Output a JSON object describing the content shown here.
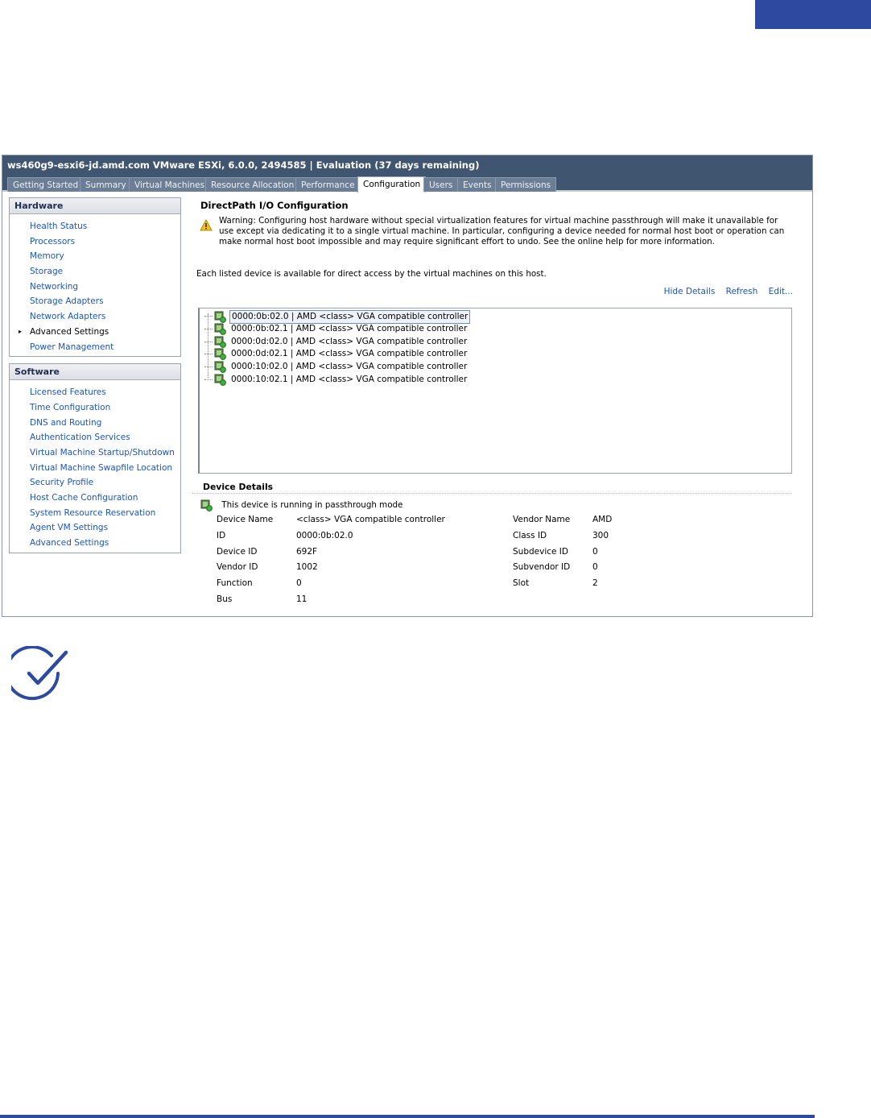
{
  "window": {
    "title": "ws460g9-esxi6-jd.amd.com VMware ESXi, 6.0.0, 2494585 | Evaluation (37 days remaining)"
  },
  "tabs": [
    {
      "label": "Getting Started"
    },
    {
      "label": "Summary"
    },
    {
      "label": "Virtual Machines"
    },
    {
      "label": "Resource Allocation"
    },
    {
      "label": "Performance"
    },
    {
      "label": "Configuration",
      "active": true
    },
    {
      "label": "Users"
    },
    {
      "label": "Events"
    },
    {
      "label": "Permissions"
    }
  ],
  "hardware": {
    "header": "Hardware",
    "items": [
      {
        "label": "Health Status"
      },
      {
        "label": "Processors"
      },
      {
        "label": "Memory"
      },
      {
        "label": "Storage"
      },
      {
        "label": "Networking"
      },
      {
        "label": "Storage Adapters"
      },
      {
        "label": "Network Adapters"
      },
      {
        "label": "Advanced Settings",
        "current": true
      },
      {
        "label": "Power Management"
      }
    ]
  },
  "software": {
    "header": "Software",
    "items": [
      {
        "label": "Licensed Features"
      },
      {
        "label": "Time Configuration"
      },
      {
        "label": "DNS and Routing"
      },
      {
        "label": "Authentication Services"
      },
      {
        "label": "Virtual Machine Startup/Shutdown"
      },
      {
        "label": "Virtual Machine Swapfile Location"
      },
      {
        "label": "Security Profile"
      },
      {
        "label": "Host Cache Configuration"
      },
      {
        "label": "System Resource Reservation"
      },
      {
        "label": "Agent VM Settings"
      },
      {
        "label": "Advanced Settings"
      }
    ]
  },
  "main": {
    "title": "DirectPath I/O Configuration",
    "warning": "Warning: Configuring host hardware without special virtualization features for virtual machine passthrough will make it unavailable for use except via dedicating it to a single virtual machine. In particular, configuring a device needed for normal host boot or operation can make normal host boot impossible and may require significant effort to undo. See the online help for more information.",
    "info": "Each listed device is available for direct access by the virtual machines on this host.",
    "links": {
      "hide_details": "Hide Details",
      "refresh": "Refresh",
      "edit": "Edit..."
    },
    "devices": [
      {
        "label": "0000:0b:02.0 | AMD <class> VGA compatible controller",
        "selected": true
      },
      {
        "label": "0000:0b:02.1 | AMD <class> VGA compatible controller"
      },
      {
        "label": "0000:0d:02.0 | AMD <class> VGA compatible controller"
      },
      {
        "label": "0000:0d:02.1 | AMD <class> VGA compatible controller"
      },
      {
        "label": "0000:10:02.0 | AMD <class> VGA compatible controller"
      },
      {
        "label": "0000:10:02.1 | AMD <class> VGA compatible controller"
      }
    ],
    "details": {
      "title": "Device Details",
      "status": "This device is running in passthrough mode",
      "left": [
        {
          "label": "Device Name",
          "value": "<class> VGA compatible controller"
        },
        {
          "label": "ID",
          "value": "0000:0b:02.0"
        },
        {
          "label": "Device ID",
          "value": "692F"
        },
        {
          "label": "Vendor ID",
          "value": "1002"
        },
        {
          "label": "Function",
          "value": "0"
        },
        {
          "label": "Bus",
          "value": "11"
        }
      ],
      "right": [
        {
          "label": "Vendor Name",
          "value": "AMD"
        },
        {
          "label": "Class ID",
          "value": "300"
        },
        {
          "label": "Subdevice ID",
          "value": "0"
        },
        {
          "label": "Subvendor ID",
          "value": "0"
        },
        {
          "label": "Slot",
          "value": "2"
        }
      ]
    }
  },
  "icons": {
    "warning": "warning-triangle-icon",
    "device": "pci-device-passthrough-icon",
    "check": "checkmark-circle-icon",
    "bullet": "triangle-right-icon"
  },
  "colors": {
    "brand_blue": "#2d4aa0",
    "title_bar": "#3f5570",
    "link": "#1a55c4"
  }
}
